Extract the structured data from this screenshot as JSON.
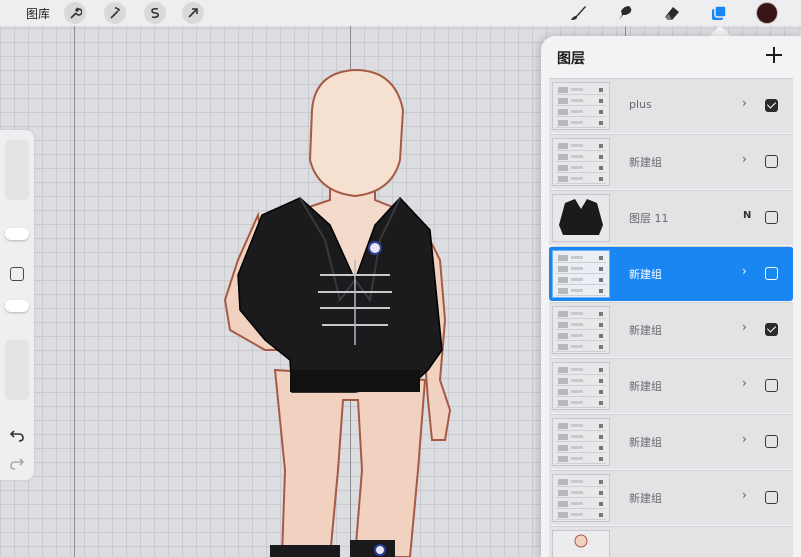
{
  "topbar": {
    "gallery_label": "图库",
    "left_tools": [
      "wrench-icon",
      "magic-wand-icon",
      "selection-icon",
      "transform-arrow-icon"
    ],
    "right_tools": [
      "brush-icon",
      "smudge-icon",
      "eraser-icon",
      "layers-icon",
      "color-swatch"
    ],
    "active_color": "#3a1518",
    "accent": "#1a86f2"
  },
  "layers_panel": {
    "title": "图层",
    "add_label": "+",
    "rows": [
      {
        "name": "plus",
        "type": "group",
        "visible": true,
        "selected": false
      },
      {
        "name": "新建组",
        "type": "group",
        "visible": false,
        "selected": false
      },
      {
        "name": "图层 11",
        "type": "layer",
        "blend": "N",
        "visible": false,
        "selected": false
      },
      {
        "name": "新建组",
        "type": "group",
        "visible": false,
        "selected": true
      },
      {
        "name": "新建组",
        "type": "group",
        "visible": true,
        "selected": false
      },
      {
        "name": "新建组",
        "type": "group",
        "visible": false,
        "selected": false
      },
      {
        "name": "新建组",
        "type": "group",
        "visible": false,
        "selected": false
      },
      {
        "name": "新建组",
        "type": "group",
        "visible": false,
        "selected": false
      }
    ]
  }
}
